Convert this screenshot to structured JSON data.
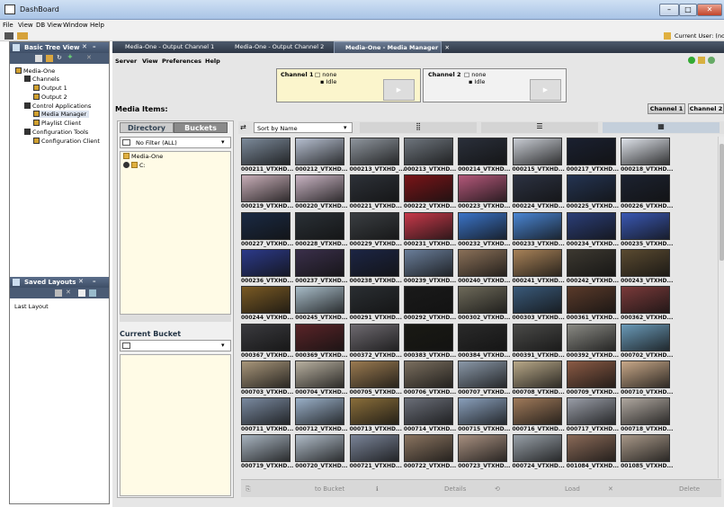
{
  "window": {
    "title": "DashBoard",
    "current_user": "Current User: (non"
  },
  "menubar": [
    "File",
    "View",
    "DB View",
    "Window",
    "Help"
  ],
  "left_panel": {
    "title": "Basic Tree View",
    "tree": [
      {
        "label": "Media-One",
        "level": 0
      },
      {
        "label": "Channels",
        "level": 1
      },
      {
        "label": "Output 1",
        "level": 2
      },
      {
        "label": "Output 2",
        "level": 2
      },
      {
        "label": "Control Applications",
        "level": 1
      },
      {
        "label": "Media Manager",
        "level": 2,
        "selected": true
      },
      {
        "label": "Playlist Client",
        "level": 2
      },
      {
        "label": "Configuration Tools",
        "level": 1
      },
      {
        "label": "Configuration Client",
        "level": 2
      }
    ]
  },
  "saved_layouts": {
    "title": "Saved Layouts",
    "items": [
      "Last Layout"
    ]
  },
  "tabs": [
    {
      "label": "Media-One - Output Channel 1",
      "active": false
    },
    {
      "label": "Media-One - Output Channel 2",
      "active": false
    },
    {
      "label": "Media-One - Media Manager",
      "active": true
    }
  ],
  "sub_menu": [
    "Server",
    "View",
    "Preferences",
    "Help"
  ],
  "channel1": {
    "name": "Channel 1",
    "clip": "none",
    "status": "Idle"
  },
  "channel2": {
    "name": "Channel 2",
    "clip": "none",
    "status": "Idle"
  },
  "media_items_label": "Media Items:",
  "channel_buttons": [
    "Channel 1",
    "Channel 2"
  ],
  "dir_tabs": [
    "Directory",
    "Buckets"
  ],
  "filter_value": "No Filter (ALL)",
  "dir_tree": [
    "Media-One",
    "C:"
  ],
  "current_bucket_label": "Current Bucket",
  "sort_value": "Sort by Name",
  "items": [
    "000211_VTXHD...",
    "000212_VTXHD...",
    "000213_VTXHD_...",
    "000213_VTXHD...",
    "000214_VTXHD...",
    "000215_VTXHD...",
    "000217_VTXHD...",
    "000218_VTXHD...",
    "000219_VTXHD...",
    "000220_VTXHD...",
    "000221_VTXHD...",
    "000222_VTXHD...",
    "000223_VTXHD...",
    "000224_VTXHD...",
    "000225_VTXHD...",
    "000226_VTXHD...",
    "000227_VTXHD...",
    "000228_VTXHD...",
    "000229_VTXHD...",
    "000231_VTXHD...",
    "000232_VTXHD...",
    "000233_VTXHD...",
    "000234_VTXHD...",
    "000235_VTXHD...",
    "000236_VTXHD...",
    "000237_VTXHD...",
    "000238_VTXHD...",
    "000239_VTXHD...",
    "000240_VTXHD...",
    "000241_VTXHD...",
    "000242_VTXHD...",
    "000243_VTXHD...",
    "000244_VTXHD...",
    "000245_VTXHD...",
    "000291_VTXHD...",
    "000292_VTXHD...",
    "000302_VTXHD...",
    "000303_VTXHD...",
    "000361_VTXHD...",
    "000362_VTXHD...",
    "000367_VTXHD...",
    "000369_VTXHD...",
    "000372_VTXHD...",
    "000383_VTXHD...",
    "000384_VTXHD...",
    "000391_VTXHD...",
    "000392_VTXHD...",
    "000702_VTXHD...",
    "000703_VTXHD...",
    "000704_VTXHD...",
    "000705_VTXHD...",
    "000706_VTXHD...",
    "000707_VTXHD...",
    "000708_VTXHD...",
    "000709_VTXHD...",
    "000710_VTXHD...",
    "000711_VTXHD...",
    "000712_VTXHD...",
    "000713_VTXHD...",
    "000714_VTXHD...",
    "000715_VTXHD...",
    "000716_VTXHD...",
    "000717_VTXHD...",
    "000718_VTXHD...",
    "000719_VTXHD...",
    "000720_VTXHD...",
    "000721_VTXHD...",
    "000722_VTXHD...",
    "000723_VTXHD...",
    "000724_VTXHD...",
    "001084_VTXHD...",
    "001085_VTXHD..."
  ],
  "thumb_colors": [
    "#7c8a9a",
    "#b6bfd0",
    "#8f969e",
    "#6e757d",
    "#2a2f3a",
    "#c9cdd4",
    "#1a2030",
    "#dfe3ea",
    "#c8aeb8",
    "#c9b4c3",
    "#2d3138",
    "#7a1418",
    "#b4587a",
    "#2c3242",
    "#243452",
    "#1c2230",
    "#1a2a44",
    "#2a3036",
    "#3a3e42",
    "#c8394a",
    "#3b74c8",
    "#4a86d4",
    "#2b3e78",
    "#3a58b4",
    "#2c3a8a",
    "#3a2f4a",
    "#1c2544",
    "#6a7e9a",
    "#8a7058",
    "#a88258",
    "#3c3830",
    "#5a4a30",
    "#7a5a24",
    "#a8bcc8",
    "#2a2e32",
    "#1a1a1a",
    "#6e6a5a",
    "#3a5a7a",
    "#5a3a2a",
    "#7a3a3a",
    "#3a3a3e",
    "#5a2428",
    "#6e6a70",
    "#1a1a14",
    "#2a2a2a",
    "#4a4a48",
    "#8a8a84",
    "#6a9ab8",
    "#a8967a",
    "#b8b0a0",
    "#9a7a50",
    "#7a6e5e",
    "#8a98a8",
    "#b8a888",
    "#8a5a44",
    "#c8a888",
    "#7a8aa0",
    "#9ab0c8",
    "#8a6e3a",
    "#6a6e78",
    "#8aa0bc",
    "#a07a5a",
    "#9a9ea8",
    "#b0a8a0",
    "#a8b4c0",
    "#b0bcc8",
    "#7a8498",
    "#8a7460",
    "#a89080",
    "#98a0a8",
    "#8a6a58",
    "#a89888"
  ],
  "bottom_actions": [
    "to Bucket",
    "Details",
    "Load",
    "Delete"
  ]
}
